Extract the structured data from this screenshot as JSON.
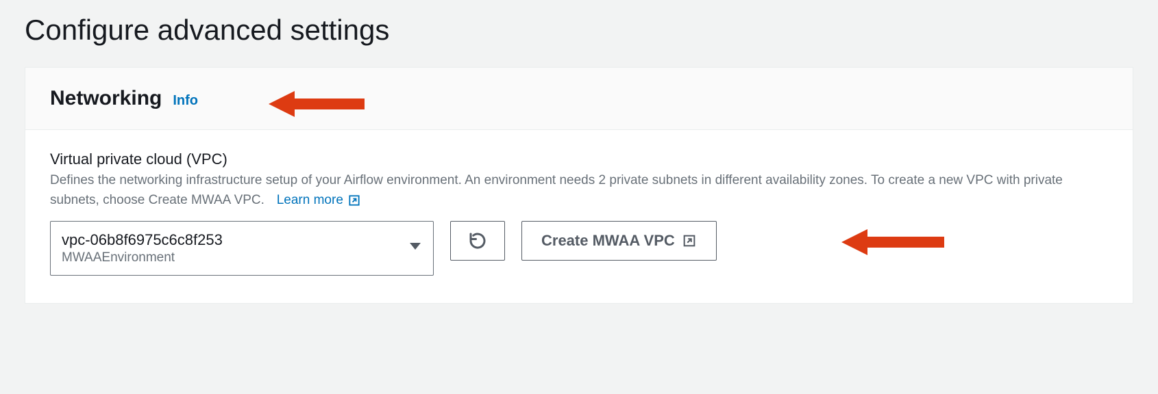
{
  "page": {
    "title": "Configure advanced settings"
  },
  "panel": {
    "heading": "Networking",
    "info_label": "Info"
  },
  "vpc_field": {
    "label": "Virtual private cloud (VPC)",
    "description": "Defines the networking infrastructure setup of your Airflow environment. An environment needs 2 private subnets in different availability zones. To create a new VPC with private subnets, choose Create MWAA VPC.",
    "learn_more": "Learn more",
    "selected_value": "vpc-06b8f6975c6c8f253",
    "selected_sub": "MWAAEnvironment",
    "create_button": "Create MWAA VPC"
  }
}
